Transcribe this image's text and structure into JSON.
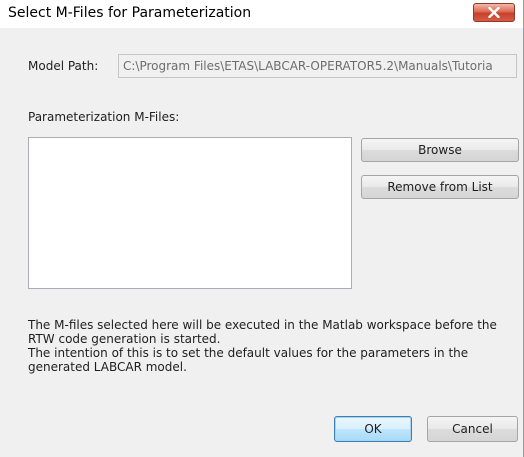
{
  "window": {
    "title": "Select M-Files for Parameterization",
    "close_icon": "close-icon"
  },
  "model_path": {
    "label": "Model Path:",
    "value": "C:\\Program Files\\ETAS\\LABCAR-OPERATOR5.2\\Manuals\\Tutoria"
  },
  "parameterization": {
    "label": "Parameterization M-Files:",
    "items": []
  },
  "buttons": {
    "browse": "Browse",
    "remove": "Remove from List",
    "ok": "OK",
    "cancel": "Cancel"
  },
  "description": {
    "line1": "The M-files selected here will be executed in the Matlab workspace before the",
    "line2": "RTW code generation is started.",
    "line3": "The intention of this is to set the default values for the parameters in the",
    "line4": "generated LABCAR model."
  },
  "colors": {
    "close_button": "#c7402a",
    "default_button_border": "#3c7fb1",
    "dialog_background": "#f0f0f0"
  }
}
